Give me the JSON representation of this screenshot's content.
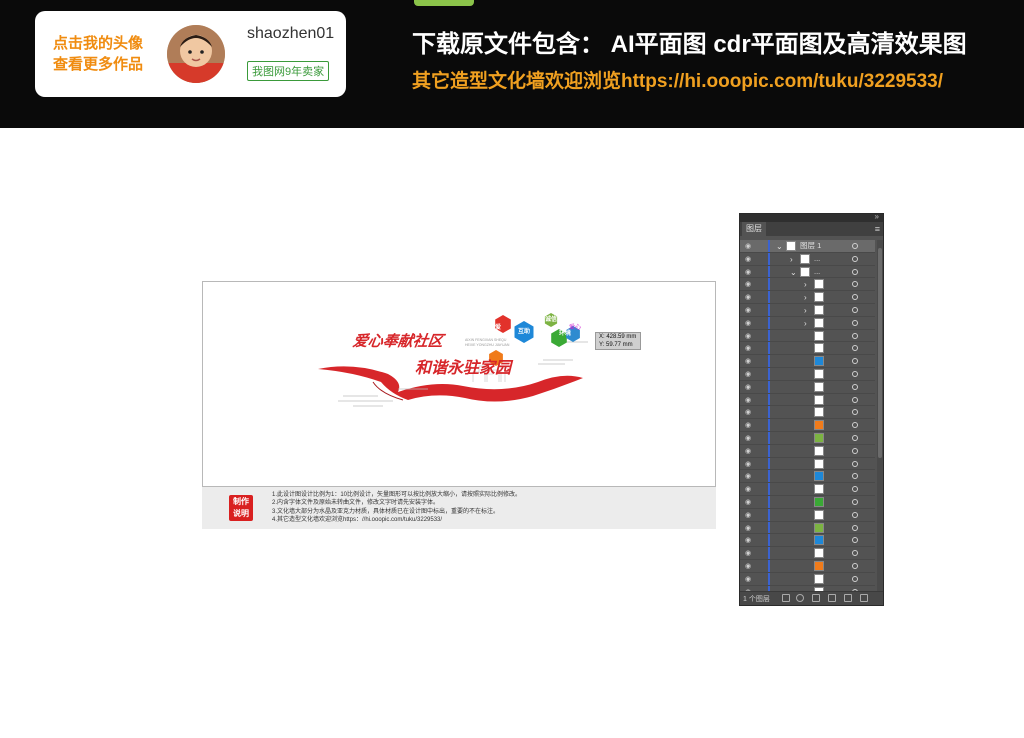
{
  "banner": {
    "author_cta_line1": "点击我的头像",
    "author_cta_line2": "查看更多作品",
    "author_name": "shaozhen01",
    "author_badge": "我图网9年卖家",
    "download_line": "下载原文件包含：  AI平面图  cdr平面图及高清效果图",
    "browse_line": "其它造型文化墙欢迎浏览https://hi.ooopic.com/tuku/3229533/"
  },
  "artwork": {
    "title_line1": "爱心奉献社区",
    "title_line2": "和谐永驻家园",
    "subtitle_en": "AIXIN FENGXIAN SHEQU HEXIE YONGZHU JIAYUAN",
    "hexagons": [
      {
        "label": "互助",
        "color": "#1e88d8"
      },
      {
        "label": "智慧",
        "color": "#3aa935"
      },
      {
        "label": "尊老",
        "color": "#f07b1a"
      },
      {
        "label": "友爱",
        "color": "#e2322b"
      },
      {
        "label": "诚信",
        "color": "#7cb342"
      },
      {
        "label": "环境",
        "color": "#2e8bd0"
      }
    ],
    "float_tag": "爱心",
    "coord_x": "X: 428.59 mm",
    "coord_y": "Y: 59.77 mm"
  },
  "notes": {
    "stamp_line1": "制作",
    "stamp_line2": "说明",
    "items": [
      "1.此设计图设计比例为1：10比例设计，矢量图形可以按比例放大缩小，请按照实际比例修改。",
      "2.内含字体文件及原始未转曲文件，修改文字时请先安装字体。",
      "3.文化墙大部分为水晶及亚克力材质，具体材质已在设计图中标出，重要的不在标注。",
      "4.其它造型文化墙欢迎浏览https：//hi.ooopic.com/tuku/3229533/"
    ]
  },
  "layers_panel": {
    "tab": "图层",
    "layer_count": "1 个图层",
    "rows": [
      {
        "name": "图层 1",
        "level": 0,
        "expand": "⌄",
        "thumb": "#ffffff",
        "active": true
      },
      {
        "name": "...",
        "level": 1,
        "expand": "›",
        "thumb": "#ffffff"
      },
      {
        "name": "...",
        "level": 1,
        "expand": "⌄",
        "thumb": "#ffffff"
      },
      {
        "name": "",
        "level": 2,
        "expand": "›",
        "thumb": "#ffffff"
      },
      {
        "name": "",
        "level": 2,
        "expand": "›",
        "thumb": "#ffffff"
      },
      {
        "name": "",
        "level": 2,
        "expand": "›",
        "thumb": "#ffffff"
      },
      {
        "name": "",
        "level": 2,
        "expand": "›",
        "thumb": "#ffffff"
      },
      {
        "name": "",
        "level": 2,
        "expand": "",
        "thumb": "#ffffff"
      },
      {
        "name": "",
        "level": 2,
        "expand": "",
        "thumb": "#ffffff"
      },
      {
        "name": "",
        "level": 2,
        "expand": "",
        "thumb": "#1e88d8"
      },
      {
        "name": "",
        "level": 2,
        "expand": "",
        "thumb": "#ffffff"
      },
      {
        "name": "",
        "level": 2,
        "expand": "",
        "thumb": "#ffffff"
      },
      {
        "name": "",
        "level": 2,
        "expand": "",
        "thumb": "#ffffff"
      },
      {
        "name": "",
        "level": 2,
        "expand": "",
        "thumb": "#ffffff"
      },
      {
        "name": "",
        "level": 2,
        "expand": "",
        "thumb": "#f07b1a"
      },
      {
        "name": "",
        "level": 2,
        "expand": "",
        "thumb": "#7cb342"
      },
      {
        "name": "",
        "level": 2,
        "expand": "",
        "thumb": "#ffffff"
      },
      {
        "name": "",
        "level": 2,
        "expand": "",
        "thumb": "#ffffff"
      },
      {
        "name": "",
        "level": 2,
        "expand": "",
        "thumb": "#1e88d8"
      },
      {
        "name": "",
        "level": 2,
        "expand": "",
        "thumb": "#ffffff"
      },
      {
        "name": "",
        "level": 2,
        "expand": "",
        "thumb": "#3aa935"
      },
      {
        "name": "",
        "level": 2,
        "expand": "",
        "thumb": "#ffffff"
      },
      {
        "name": "",
        "level": 2,
        "expand": "",
        "thumb": "#7cb342"
      },
      {
        "name": "",
        "level": 2,
        "expand": "",
        "thumb": "#1e88d8"
      },
      {
        "name": "",
        "level": 2,
        "expand": "",
        "thumb": "#ffffff"
      },
      {
        "name": "",
        "level": 2,
        "expand": "",
        "thumb": "#f07b1a"
      },
      {
        "name": "",
        "level": 2,
        "expand": "",
        "thumb": "#ffffff"
      },
      {
        "name": "",
        "level": 2,
        "expand": "›",
        "thumb": "#ffffff"
      }
    ]
  }
}
